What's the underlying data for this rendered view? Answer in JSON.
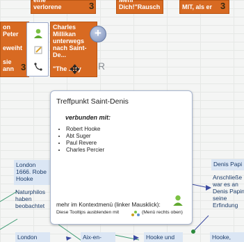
{
  "nodes": {
    "top_left": {
      "text": "eine\nverlorene",
      "count": "3"
    },
    "top_mid": {
      "text": "Mehr\nDich!\"Rausch",
      "count": ""
    },
    "top_right": {
      "text": "MIT, als er",
      "count": "3"
    },
    "left_card": {
      "text": "on\nPeter\n\neweiht\n\nsie\nann",
      "count": "3"
    },
    "charles": {
      "text": "Charles\nMillikan\nunterwegs\nnach Saint-\nDe...\n\n\"The ...ity",
      "count": ""
    },
    "london_1666": {
      "title": "London\n1666. Robe\nHooke",
      "body": "Naturphilos\nhaben\nbeobachtet"
    },
    "denis_papin": {
      "title": "Denis Papi",
      "body": "Anschließe\nwar es an\nDenis Papin\nseine\nErfindung"
    },
    "london_bottom": {
      "title": "London"
    },
    "aix": {
      "title": "Aix-en-"
    },
    "hooke_und": {
      "title": "Hooke und"
    },
    "hooke_right": {
      "title": "Hooke,"
    }
  },
  "toolbar": {
    "items": [
      {
        "icon": "user-icon"
      },
      {
        "icon": "edit-icon"
      },
      {
        "icon": "connect-icon"
      }
    ]
  },
  "tooltip": {
    "title": "Treffpunkt Saint-Denis",
    "subtitle": "verbunden mit:",
    "connections": [
      "Robert Hooke",
      "Abt Suger",
      "Paul Revere",
      "Charles Percier"
    ],
    "more": "mehr im Kontextmenü (linker Mausklick):",
    "hide": "Diese Tooltips ausblenden mit",
    "hide_hint": "(Menü rechts oben)"
  },
  "colors": {
    "orange": "#d86a22",
    "blue": "#dbe6f4",
    "link": "#3d9a73"
  }
}
